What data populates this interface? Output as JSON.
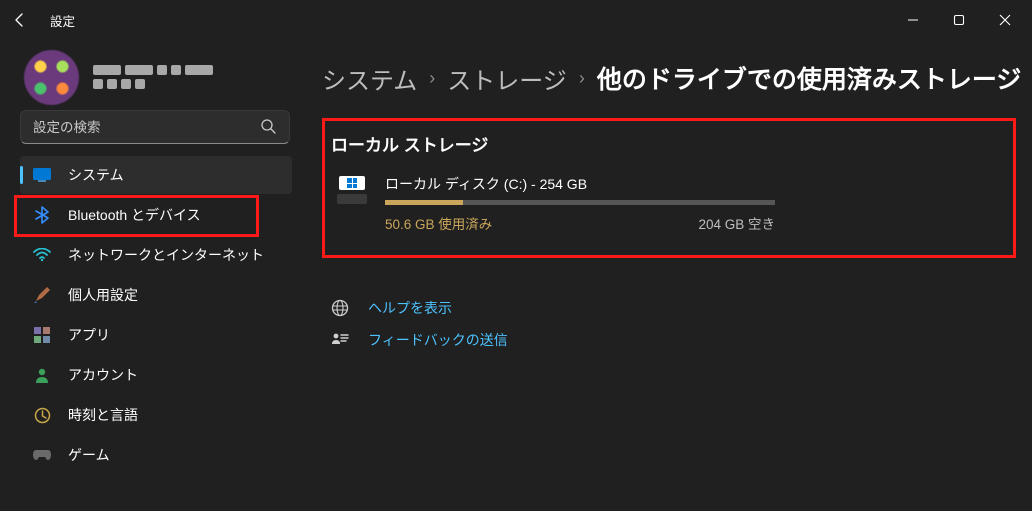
{
  "window": {
    "title": "設定"
  },
  "search": {
    "placeholder": "設定の検索"
  },
  "sidebar": {
    "items": [
      {
        "label": "システム"
      },
      {
        "label": "Bluetooth とデバイス"
      },
      {
        "label": "ネットワークとインターネット"
      },
      {
        "label": "個人用設定"
      },
      {
        "label": "アプリ"
      },
      {
        "label": "アカウント"
      },
      {
        "label": "時刻と言語"
      },
      {
        "label": "ゲーム"
      }
    ]
  },
  "breadcrumb": {
    "a": "システム",
    "b": "ストレージ",
    "c": "他のドライブでの使用済みストレージ",
    "sep": "›"
  },
  "section": {
    "title": "ローカル ストレージ"
  },
  "drive": {
    "label": "ローカル ディスク (C:) - 254 GB",
    "used_text": "50.6 GB 使用済み",
    "free_text": "204 GB 空き",
    "used_gb": 50.6,
    "total_gb": 254
  },
  "links": {
    "help": "ヘルプを表示",
    "feedback": "フィードバックの送信"
  }
}
